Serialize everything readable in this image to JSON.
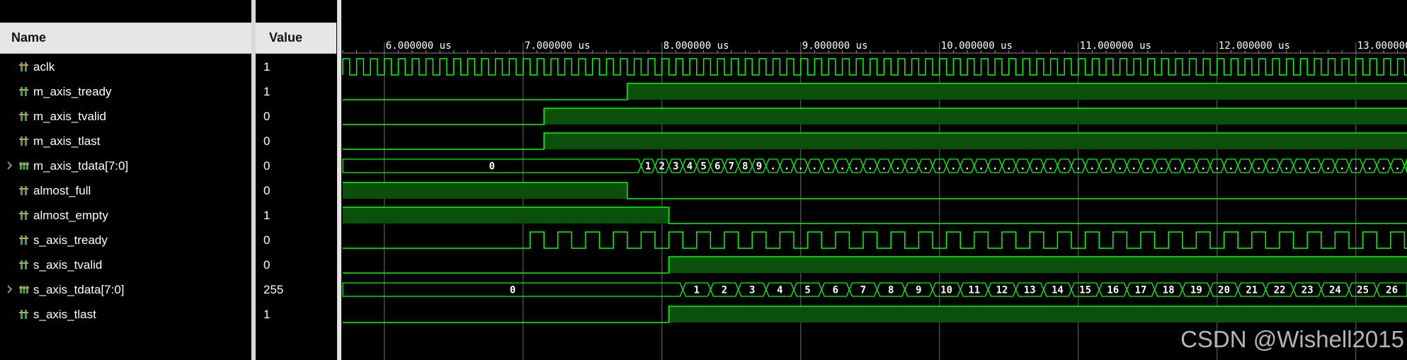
{
  "header": {
    "name_label": "Name",
    "value_label": "Value"
  },
  "signals": [
    {
      "name": "aclk",
      "value": "1",
      "bus": false,
      "icon": "wire-signal-icon"
    },
    {
      "name": "m_axis_tready",
      "value": "1",
      "bus": false,
      "icon": "wire-signal-icon"
    },
    {
      "name": "m_axis_tvalid",
      "value": "0",
      "bus": false,
      "icon": "wire-signal-icon"
    },
    {
      "name": "m_axis_tlast",
      "value": "0",
      "bus": false,
      "icon": "wire-signal-icon"
    },
    {
      "name": "m_axis_tdata[7:0]",
      "value": "0",
      "bus": true,
      "icon": "bus-signal-icon"
    },
    {
      "name": "almost_full",
      "value": "0",
      "bus": false,
      "icon": "wire-signal-icon"
    },
    {
      "name": "almost_empty",
      "value": "1",
      "bus": false,
      "icon": "wire-signal-icon"
    },
    {
      "name": "s_axis_tready",
      "value": "0",
      "bus": false,
      "icon": "wire-signal-icon"
    },
    {
      "name": "s_axis_tvalid",
      "value": "0",
      "bus": false,
      "icon": "wire-signal-icon"
    },
    {
      "name": "s_axis_tdata[7:0]",
      "value": "255",
      "bus": true,
      "icon": "bus-signal-icon"
    },
    {
      "name": "s_axis_tlast",
      "value": "1",
      "bus": false,
      "icon": "wire-signal-icon"
    }
  ],
  "timeline": {
    "unit": "us",
    "labels": [
      "6.000000 us",
      "7.000000 us",
      "8.000000 us",
      "9.000000 us",
      "10.000000 us",
      "11.000000 us",
      "12.000000 us",
      "13.000000"
    ]
  },
  "colors": {
    "wave": "#00ff00",
    "fill": "#0a4f0a",
    "grid": "#6e6e6e",
    "text": "#ffffff"
  },
  "waveforms": {
    "clock_period_us": 0.1,
    "m_axis_tready_rise_us": 7.75,
    "m_axis_tvalid_rise_us": 7.15,
    "m_axis_tlast_rise_us": 7.15,
    "m_axis_tdata_initial": "0",
    "m_axis_tdata_change_us": 7.85,
    "m_axis_tdata_values": [
      "1",
      "2",
      "3",
      "4",
      "5",
      "6",
      "7",
      "8",
      "9"
    ],
    "m_axis_tdata_more": ".",
    "almost_full_fall_us": 7.75,
    "almost_empty_fall_us": 8.05,
    "s_axis_tready_start_us": 7.05,
    "s_axis_tready_period_us": 0.2,
    "s_axis_tvalid_rise_us": 8.05,
    "s_axis_tdata_initial": "0",
    "s_axis_tdata_change_us": 8.15,
    "s_axis_tdata_values": [
      "1",
      "2",
      "3",
      "4",
      "5",
      "6",
      "7",
      "8",
      "9",
      "10",
      "11",
      "12",
      "13",
      "14",
      "15",
      "16",
      "17",
      "18",
      "19",
      "20",
      "21",
      "22",
      "23",
      "24",
      "25",
      "26"
    ],
    "s_axis_tdata_step_us": 0.2,
    "s_axis_tlast_rise_us": 8.05
  },
  "watermark": "CSDN @Wishell2015"
}
